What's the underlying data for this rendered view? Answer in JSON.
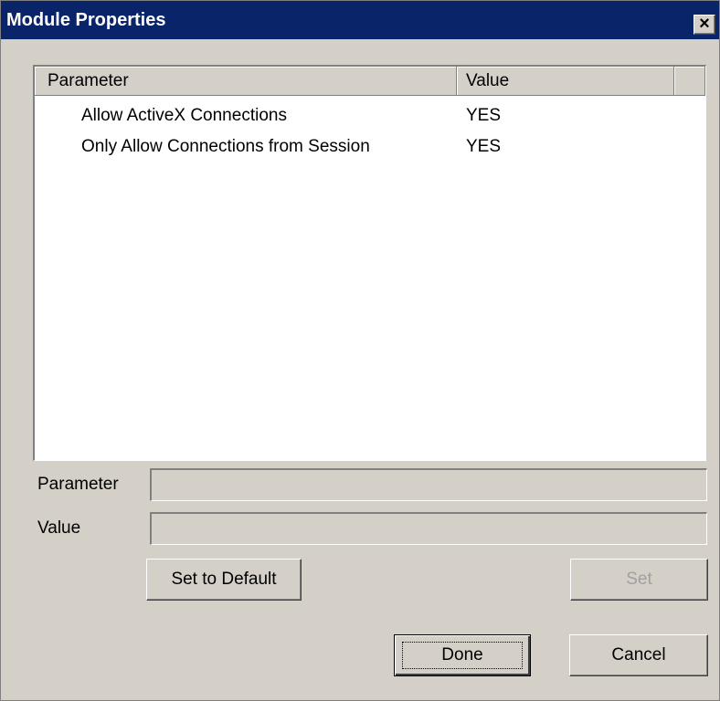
{
  "window": {
    "title": "Module Properties",
    "close_glyph": "✕",
    "close_icon": "close-icon"
  },
  "list": {
    "columns": [
      "Parameter",
      "Value"
    ],
    "rows": [
      {
        "parameter": "Allow ActiveX Connections",
        "value": "YES"
      },
      {
        "parameter": "Only Allow Connections from Session",
        "value": "YES"
      }
    ]
  },
  "form": {
    "parameter_label": "Parameter",
    "parameter_value": "",
    "value_label": "Value",
    "value_value": ""
  },
  "buttons": {
    "set_to_default": "Set to Default",
    "set": "Set",
    "done": "Done",
    "cancel": "Cancel"
  },
  "colors": {
    "titlebar": "#0a246a",
    "face": "#d4d0c8",
    "disabled_text": "#a0a0a0"
  }
}
